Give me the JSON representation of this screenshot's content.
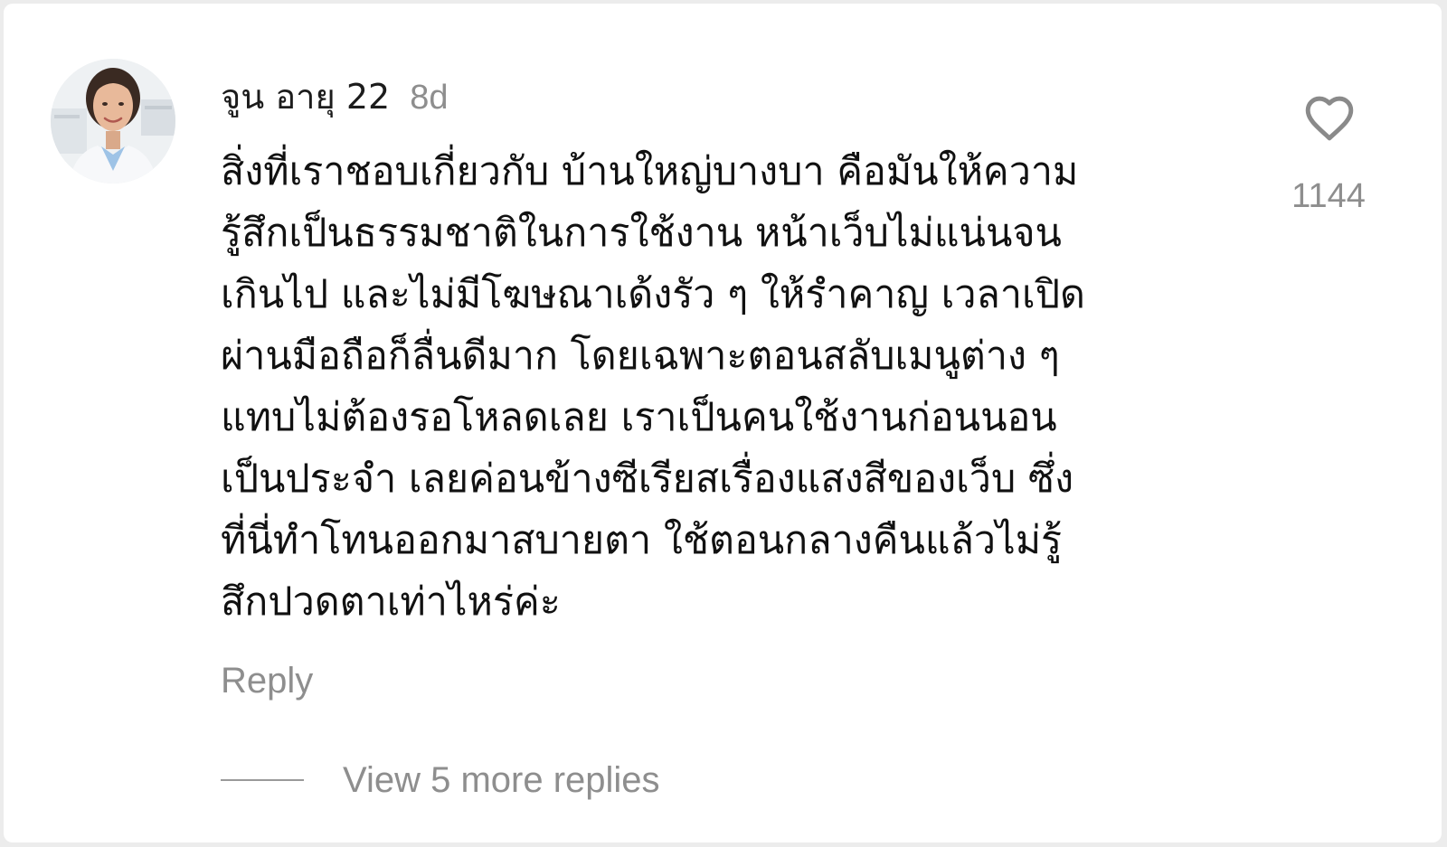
{
  "comment": {
    "username": "จูน อายุ 22",
    "timestamp": "8d",
    "body": "สิ่งที่เราชอบเกี่ยวกับ บ้านใหญ่บางบา คือมันให้ความ\nรู้สึกเป็นธรรมชาติในการใช้งาน หน้าเว็บไม่แน่นจน\nเกินไป และไม่มีโฆษณาเด้งรัว ๆ ให้รำคาญ เวลาเปิด\nผ่านมือถือก็ลื่นดีมาก โดยเฉพาะตอนสลับเมนูต่าง ๆ\nแทบไม่ต้องรอโหลดเลย เราเป็นคนใช้งานก่อนนอน\nเป็นประจำ เลยค่อนข้างซีเรียสเรื่องแสงสีของเว็บ ซึ่ง\nที่นี่ทำโทนออกมาสบายตา ใช้ตอนกลางคืนแล้วไม่รู้\nสึกปวดตาเท่าไหร่ค่ะ",
    "like_icon": "heart-outline-icon",
    "like_count": "1144",
    "reply_label": "Reply",
    "view_replies_label": "View 5 more replies"
  },
  "colors": {
    "text_primary": "#111111",
    "text_secondary": "#8e8e8e",
    "background": "#ffffff"
  }
}
